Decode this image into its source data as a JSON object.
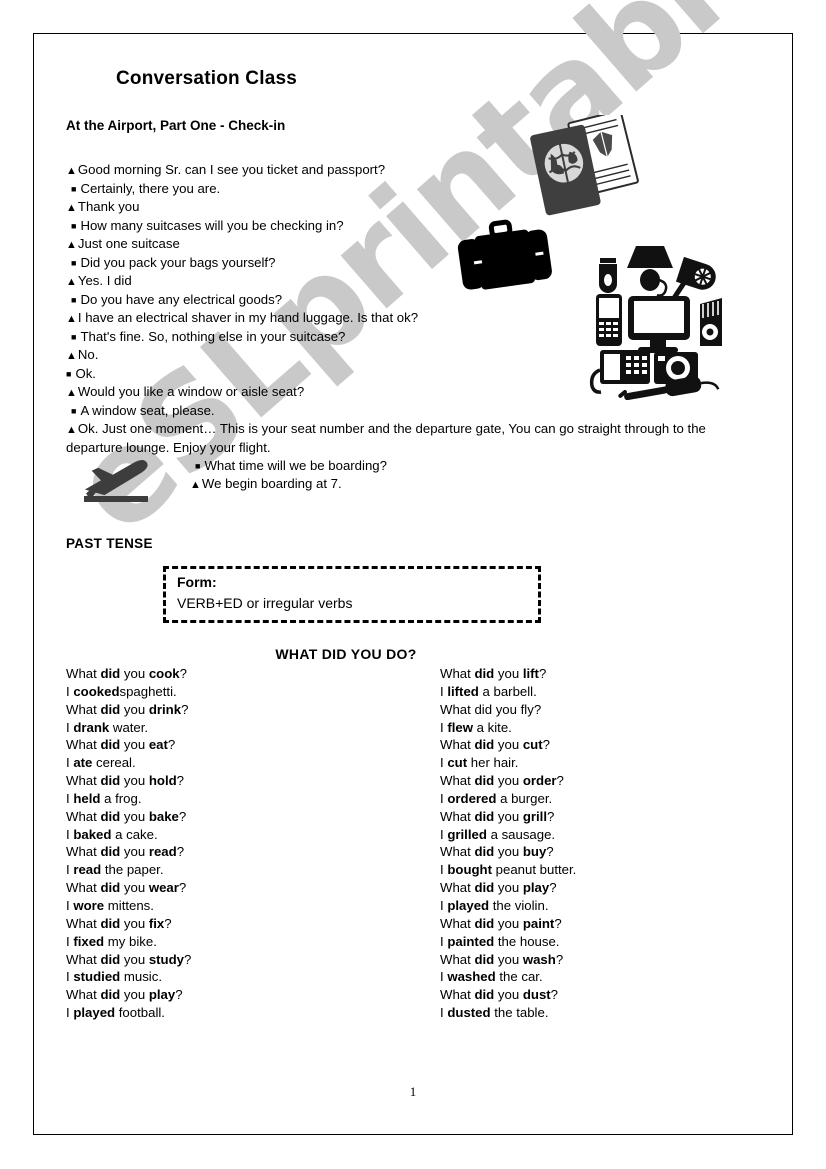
{
  "document": {
    "title": "Conversation Class",
    "subtitle": "At the Airport, Part One - Check-in",
    "page_number": "1",
    "watermark": "eSLprintables.com",
    "watermark_color": "#c9c9c9"
  },
  "dialogue": {
    "lines": [
      {
        "speaker": "triangle",
        "text": "Good morning Sr. can I see you ticket and passport?"
      },
      {
        "speaker": "square",
        "text": "Certainly, there you are."
      },
      {
        "speaker": "triangle",
        "text": "Thank you"
      },
      {
        "speaker": "square",
        "text": "How many suitcases will you be checking in?"
      },
      {
        "speaker": "triangle",
        "text": "Just one suitcase"
      },
      {
        "speaker": "square",
        "text": "Did you pack your bags yourself?"
      },
      {
        "speaker": "triangle",
        "text": "Yes. I did"
      },
      {
        "speaker": "square",
        "text": "Do you have any electrical goods?"
      },
      {
        "speaker": "triangle",
        "text": "I have an electrical shaver in my hand luggage. Is that ok?"
      },
      {
        "speaker": "square",
        "text": "That's fine. So, nothing else in your suitcase?"
      },
      {
        "speaker": "triangle",
        "text": "No."
      },
      {
        "speaker": "square",
        "text": "Ok.",
        "tight": true
      },
      {
        "speaker": "triangle",
        "text": "Would you like a window or aisle seat?"
      },
      {
        "speaker": "square",
        "text": "A window seat, please."
      },
      {
        "speaker": "triangle",
        "text": "Ok. Just one moment…  This is your seat number and the departure gate, You can go straight through to the departure lounge. Enjoy your flight.",
        "wrap": true
      }
    ]
  },
  "boarding": {
    "lines": [
      {
        "speaker": "square",
        "text": "What time will we be boarding?"
      },
      {
        "speaker": "triangle",
        "text": "We begin boarding at 7."
      }
    ]
  },
  "past_tense": {
    "label": "PAST TENSE",
    "form_title": "Form:",
    "form_body": "VERB+ED or irregular verbs"
  },
  "exercise": {
    "heading": "WHAT DID YOU DO?",
    "left_column": [
      [
        {
          "t": "What ",
          "b": false
        },
        {
          "t": "did",
          "b": true
        },
        {
          "t": " you ",
          "b": false
        },
        {
          "t": "cook",
          "b": true
        },
        {
          "t": "?",
          "b": false
        }
      ],
      [
        {
          "t": "I ",
          "b": false
        },
        {
          "t": "cooked",
          "b": true
        },
        {
          "t": "spaghetti.",
          "b": false
        }
      ],
      [
        {
          "t": "What ",
          "b": false
        },
        {
          "t": "did",
          "b": true
        },
        {
          "t": " you ",
          "b": false
        },
        {
          "t": "drink",
          "b": true
        },
        {
          "t": "?",
          "b": false
        }
      ],
      [
        {
          "t": "I ",
          "b": false
        },
        {
          "t": "drank",
          "b": true
        },
        {
          "t": " water.",
          "b": false
        }
      ],
      [
        {
          "t": "What ",
          "b": false
        },
        {
          "t": "did",
          "b": true
        },
        {
          "t": " you ",
          "b": false
        },
        {
          "t": "eat",
          "b": true
        },
        {
          "t": "?",
          "b": false
        }
      ],
      [
        {
          "t": "I ",
          "b": false
        },
        {
          "t": "ate",
          "b": true
        },
        {
          "t": " cereal.",
          "b": false
        }
      ],
      [
        {
          "t": "What ",
          "b": false
        },
        {
          "t": "did",
          "b": true
        },
        {
          "t": " you ",
          "b": false
        },
        {
          "t": "hold",
          "b": true
        },
        {
          "t": "?",
          "b": false
        }
      ],
      [
        {
          "t": "I ",
          "b": false
        },
        {
          "t": "held",
          "b": true
        },
        {
          "t": " a frog.",
          "b": false
        }
      ],
      [
        {
          "t": "What ",
          "b": false
        },
        {
          "t": "did",
          "b": true
        },
        {
          "t": " you ",
          "b": false
        },
        {
          "t": "bake",
          "b": true
        },
        {
          "t": "?",
          "b": false
        }
      ],
      [
        {
          "t": "I ",
          "b": false
        },
        {
          "t": "baked",
          "b": true
        },
        {
          "t": " a cake.",
          "b": false
        }
      ],
      [
        {
          "t": "What ",
          "b": false
        },
        {
          "t": "did",
          "b": true
        },
        {
          "t": " you ",
          "b": false
        },
        {
          "t": "read",
          "b": true
        },
        {
          "t": "?",
          "b": false
        }
      ],
      [
        {
          "t": "I ",
          "b": false
        },
        {
          "t": "read",
          "b": true
        },
        {
          "t": " the paper.",
          "b": false
        }
      ],
      [
        {
          "t": "What ",
          "b": false
        },
        {
          "t": "did",
          "b": true
        },
        {
          "t": " you ",
          "b": false
        },
        {
          "t": "wear",
          "b": true
        },
        {
          "t": "?",
          "b": false
        }
      ],
      [
        {
          "t": "I ",
          "b": false
        },
        {
          "t": "wore",
          "b": true
        },
        {
          "t": " mittens.",
          "b": false
        }
      ],
      [
        {
          "t": "What ",
          "b": false
        },
        {
          "t": "did",
          "b": true
        },
        {
          "t": " you ",
          "b": false
        },
        {
          "t": "fix",
          "b": true
        },
        {
          "t": "?",
          "b": false
        }
      ],
      [
        {
          "t": "I ",
          "b": false
        },
        {
          "t": "fixed",
          "b": true
        },
        {
          "t": " my bike.",
          "b": false
        }
      ],
      [
        {
          "t": "What ",
          "b": false
        },
        {
          "t": "did",
          "b": true
        },
        {
          "t": " you ",
          "b": false
        },
        {
          "t": "study",
          "b": true
        },
        {
          "t": "?",
          "b": false
        }
      ],
      [
        {
          "t": "I ",
          "b": false
        },
        {
          "t": "studied",
          "b": true
        },
        {
          "t": " music.",
          "b": false
        }
      ],
      [
        {
          "t": "What ",
          "b": false
        },
        {
          "t": "did",
          "b": true
        },
        {
          "t": " you ",
          "b": false
        },
        {
          "t": "play",
          "b": true
        },
        {
          "t": "?",
          "b": false
        }
      ],
      [
        {
          "t": "I ",
          "b": false
        },
        {
          "t": "played",
          "b": true
        },
        {
          "t": " football.",
          "b": false
        }
      ]
    ],
    "right_column": [
      [
        {
          "t": "What ",
          "b": false
        },
        {
          "t": "did",
          "b": true
        },
        {
          "t": " you ",
          "b": false
        },
        {
          "t": "lift",
          "b": true
        },
        {
          "t": "?",
          "b": false
        }
      ],
      [
        {
          "t": "I ",
          "b": false
        },
        {
          "t": "lifted",
          "b": true
        },
        {
          "t": " a barbell.",
          "b": false
        }
      ],
      [
        {
          "t": "What did you fly?",
          "b": false
        }
      ],
      [
        {
          "t": "I ",
          "b": false
        },
        {
          "t": "flew",
          "b": true
        },
        {
          "t": " a kite.",
          "b": false
        }
      ],
      [
        {
          "t": "What ",
          "b": false
        },
        {
          "t": "did",
          "b": true
        },
        {
          "t": " you ",
          "b": false
        },
        {
          "t": "cut",
          "b": true
        },
        {
          "t": "?",
          "b": false
        }
      ],
      [
        {
          "t": "I ",
          "b": false
        },
        {
          "t": "cut",
          "b": true
        },
        {
          "t": " her hair.",
          "b": false
        }
      ],
      [
        {
          "t": "What ",
          "b": false
        },
        {
          "t": "did",
          "b": true
        },
        {
          "t": " you ",
          "b": false
        },
        {
          "t": "order",
          "b": true
        },
        {
          "t": "?",
          "b": false
        }
      ],
      [
        {
          "t": "I ",
          "b": false
        },
        {
          "t": "ordered",
          "b": true
        },
        {
          "t": " a burger.",
          "b": false
        }
      ],
      [
        {
          "t": "What ",
          "b": false
        },
        {
          "t": "did",
          "b": true
        },
        {
          "t": " you ",
          "b": false
        },
        {
          "t": "grill",
          "b": true
        },
        {
          "t": "?",
          "b": false
        }
      ],
      [
        {
          "t": "I ",
          "b": false
        },
        {
          "t": "grilled",
          "b": true
        },
        {
          "t": " a sausage.",
          "b": false
        }
      ],
      [
        {
          "t": "What ",
          "b": false
        },
        {
          "t": "did",
          "b": true
        },
        {
          "t": " you ",
          "b": false
        },
        {
          "t": "buy",
          "b": true
        },
        {
          "t": "?",
          "b": false
        }
      ],
      [
        {
          "t": "I ",
          "b": false
        },
        {
          "t": "bought",
          "b": true
        },
        {
          "t": " peanut butter.",
          "b": false
        }
      ],
      [
        {
          "t": "What ",
          "b": false
        },
        {
          "t": "did",
          "b": true
        },
        {
          "t": " you ",
          "b": false
        },
        {
          "t": "play",
          "b": true
        },
        {
          "t": "?",
          "b": false
        }
      ],
      [
        {
          "t": "I ",
          "b": false
        },
        {
          "t": "played",
          "b": true
        },
        {
          "t": " the violin.",
          "b": false
        }
      ],
      [
        {
          "t": "What ",
          "b": false
        },
        {
          "t": "did",
          "b": true
        },
        {
          "t": " you ",
          "b": false
        },
        {
          "t": "paint",
          "b": true
        },
        {
          "t": "?",
          "b": false
        }
      ],
      [
        {
          "t": "I ",
          "b": false
        },
        {
          "t": "painted",
          "b": true
        },
        {
          "t": " the house.",
          "b": false
        }
      ],
      [
        {
          "t": "What ",
          "b": false
        },
        {
          "t": "did",
          "b": true
        },
        {
          "t": " you ",
          "b": false
        },
        {
          "t": "wash",
          "b": true
        },
        {
          "t": "?",
          "b": false
        }
      ],
      [
        {
          "t": "I ",
          "b": false
        },
        {
          "t": "washed",
          "b": true
        },
        {
          "t": " the car.",
          "b": false
        }
      ],
      [
        {
          "t": "What ",
          "b": false
        },
        {
          "t": "did",
          "b": true
        },
        {
          "t": " you ",
          "b": false
        },
        {
          "t": "dust",
          "b": true
        },
        {
          "t": "?",
          "b": false
        }
      ],
      [
        {
          "t": "I ",
          "b": false
        },
        {
          "t": "dusted",
          "b": true
        },
        {
          "t": " the table.",
          "b": false
        }
      ]
    ]
  },
  "bullets": {
    "triangle": "▲",
    "square": "■"
  },
  "clipart": [
    {
      "name": "passport-and-ticket-clipart"
    },
    {
      "name": "suitcase-clipart"
    },
    {
      "name": "electrical-goods-clipart"
    },
    {
      "name": "airplane-takeoff-clipart"
    }
  ]
}
